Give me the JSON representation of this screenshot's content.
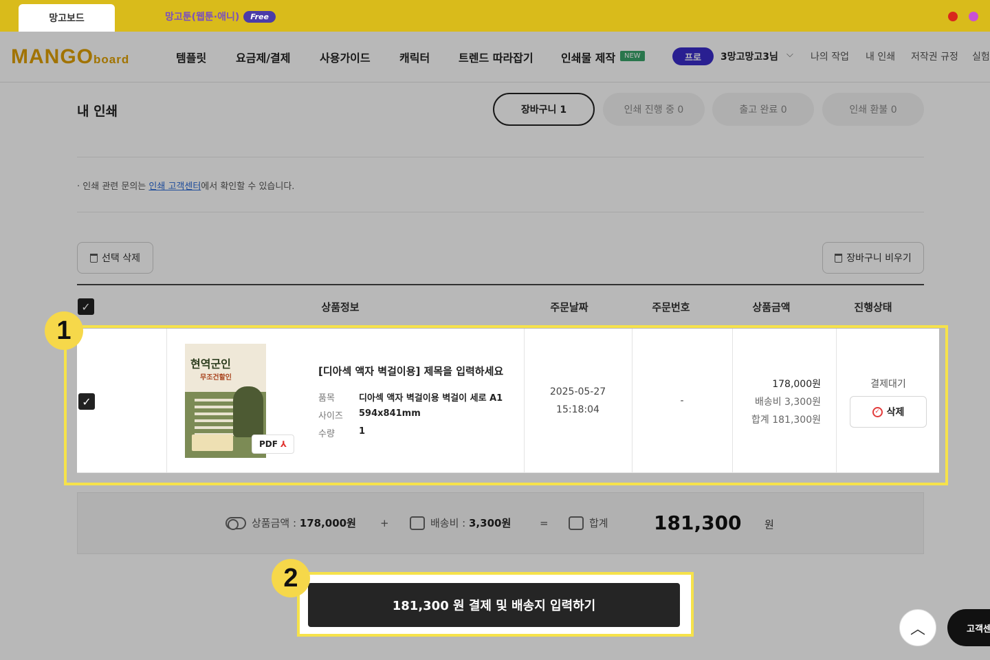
{
  "tabs": {
    "active": "망고보드",
    "second": "망고툰(웹툰·애니)",
    "free_badge": "Free"
  },
  "header": {
    "logo_main": "MANGO",
    "logo_small": "board",
    "nav": [
      "템플릿",
      "요금제/결제",
      "사용가이드",
      "캐릭터",
      "트렌드 따라잡기",
      "인쇄물 제작"
    ],
    "new_badge": "NEW",
    "pro_badge": "프로",
    "user_name": "3망고망고3님",
    "sub_nav": [
      "나의 작업",
      "내 인쇄",
      "저작권 규정",
      "실험"
    ]
  },
  "page": {
    "title": "내 인쇄",
    "status_tabs": [
      "장바구니 1",
      "인쇄 진행 중 0",
      "출고 완료 0",
      "인쇄 환불 0"
    ],
    "notice_prefix": "· 인쇄 관련 문의는 ",
    "notice_link": "인쇄 고객센터",
    "notice_suffix": "에서 확인할 수 있습니다.",
    "delete_selected": "선택 삭제",
    "empty_cart": "장바구니 비우기"
  },
  "table": {
    "headers": [
      "상품정보",
      "주문날짜",
      "주문번호",
      "상품금액",
      "진행상태"
    ],
    "row": {
      "pdf_label": "PDF",
      "product_title": "[디아섹 액자 벽걸이용] 제목을 입력하세요",
      "specs": [
        {
          "label": "품목",
          "value": "디아섹 액자 벽걸이용 벽걸이 세로 A1"
        },
        {
          "label": "사이즈",
          "value": "594x841mm"
        },
        {
          "label": "수량",
          "value": "1"
        }
      ],
      "order_date": "2025-05-27",
      "order_time": "15:18:04",
      "order_number": "-",
      "price": "178,000원",
      "shipping": "배송비 3,300원",
      "total": "합계 181,300원",
      "status": "결제대기",
      "delete_label": "삭제"
    }
  },
  "summary": {
    "goods_label": "상품금액 : ",
    "goods_value": "178,000원",
    "plus": "+",
    "shipping_label": "배송비 : ",
    "shipping_value": "3,300원",
    "equals": "=",
    "total_label": "합계",
    "total_value": "181,300",
    "unit": "원"
  },
  "pay_button": "181,300 원 결제 및 배송지 입력하기",
  "markers": [
    "1",
    "2"
  ],
  "thumbnail": {
    "title": "현역군인",
    "subtitle": "무조건할인"
  },
  "floating": {
    "customer_center": "고객센"
  },
  "colors": {
    "accent_yellow": "#d9bb1b",
    "highlight": "#f6e24a",
    "pro_purple": "#3a2cc9",
    "link_blue": "#2a6ad6"
  }
}
